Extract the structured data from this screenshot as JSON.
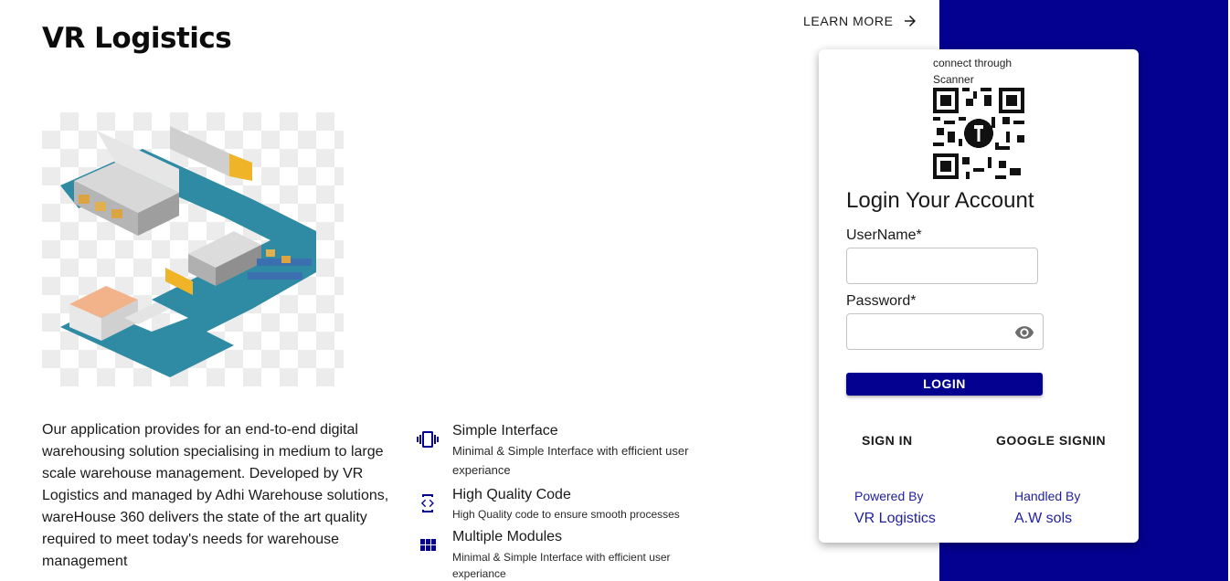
{
  "brand": {
    "title": "VR Logistics"
  },
  "header": {
    "learn_more": "LEARN MORE",
    "arrow_icon": "arrow-right-icon"
  },
  "illustration": {
    "alt": "isometric warehouse logistics illustration",
    "accent_color": "#2f8aa3"
  },
  "description": "Our application provides for an end-to-end digital warehousing solution specialising in medium to large scale warehouse management. Developed by VR Logistics and managed by Adhi Warehouse solutions, wareHouse 360 delivers the state of the art quality required to meet today's needs for warehouse management",
  "features": [
    {
      "icon": "phone-vibrate-icon",
      "title": "Simple Interface",
      "desc": "Minimal & Simple Interface with efficient user experiance"
    },
    {
      "icon": "code-icon",
      "title": "High Quality Code",
      "desc": "High Quality code to ensure smooth processes"
    },
    {
      "icon": "grid-modules-icon",
      "title": "Multiple Modules",
      "desc": "Minimal & Simple Interface with efficient user experiance"
    }
  ],
  "login": {
    "qr_label": "connect through Scanner",
    "title": "Login Your Account",
    "username_label": "UserName*",
    "username_value": "",
    "password_label": "Password*",
    "password_value": "",
    "login_button": "LOGIN",
    "signin_button": "SIGN IN",
    "google_button": "GOOGLE SIGNIN",
    "powered_by_label": "Powered By",
    "powered_by_value": "VR Logistics",
    "handled_by_label": "Handled By",
    "handled_by_value": "A.W sols"
  },
  "colors": {
    "primary": "#040190",
    "link": "#1f1fa0"
  }
}
